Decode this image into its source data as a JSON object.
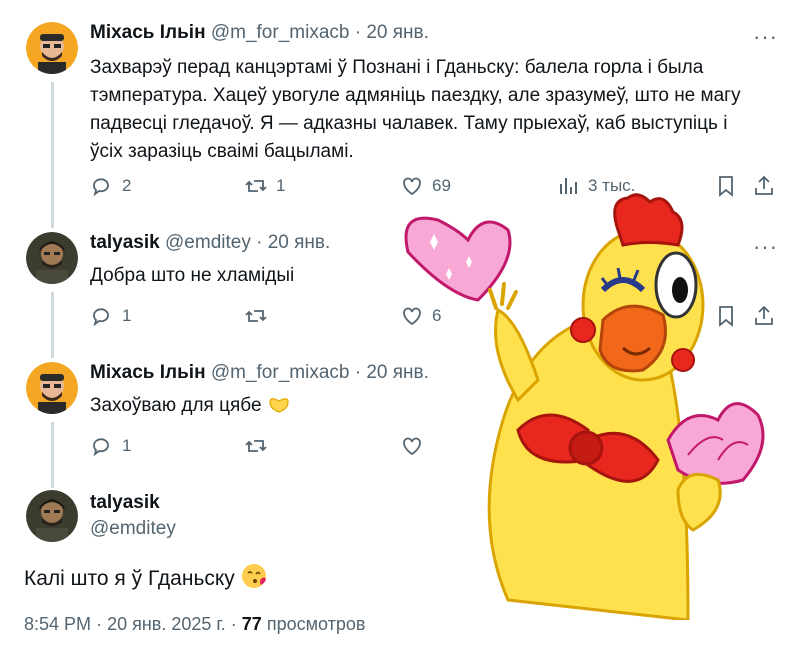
{
  "posts": [
    {
      "name": "Міхась Ільін",
      "handle": "@m_for_mixacb",
      "date": "20 янв.",
      "text": "Захварэў перад канцэртамі ў Познані і Гданьску: балела горла і была тэмпература. Хацеў увогуле адмяніць паездку, але зразумеў, што не магу падвесці гледачоў. Я — адказны чалавек. Таму прыехаў, каб выступіць і ўсіх заразіць сваімі бацыламі.",
      "replies": "2",
      "reposts": "1",
      "likes": "69",
      "views": "3 тыс."
    },
    {
      "name": "talyasik",
      "handle": "@emditey",
      "date": "20 янв.",
      "text": "Добра што не хламідыі",
      "replies": "1",
      "reposts": "",
      "likes": "6",
      "views": ""
    },
    {
      "name": "Міхась Ільін",
      "handle": "@m_for_mixacb",
      "date": "20 янв.",
      "text": "Захоўваю для цябе",
      "replies": "1",
      "reposts": "",
      "likes": "",
      "views": ""
    }
  ],
  "main": {
    "name": "talyasik",
    "handle": "@emditey",
    "text": "Калі што я ў Гданьску",
    "time": "8:54 PM",
    "date": "20 янв. 2025 г.",
    "views_count": "77",
    "views_label": "просмотров"
  },
  "dot": "·",
  "more": "···",
  "colors": {
    "muted": "#536471",
    "text": "#0f1419",
    "line": "#cfd9de"
  }
}
